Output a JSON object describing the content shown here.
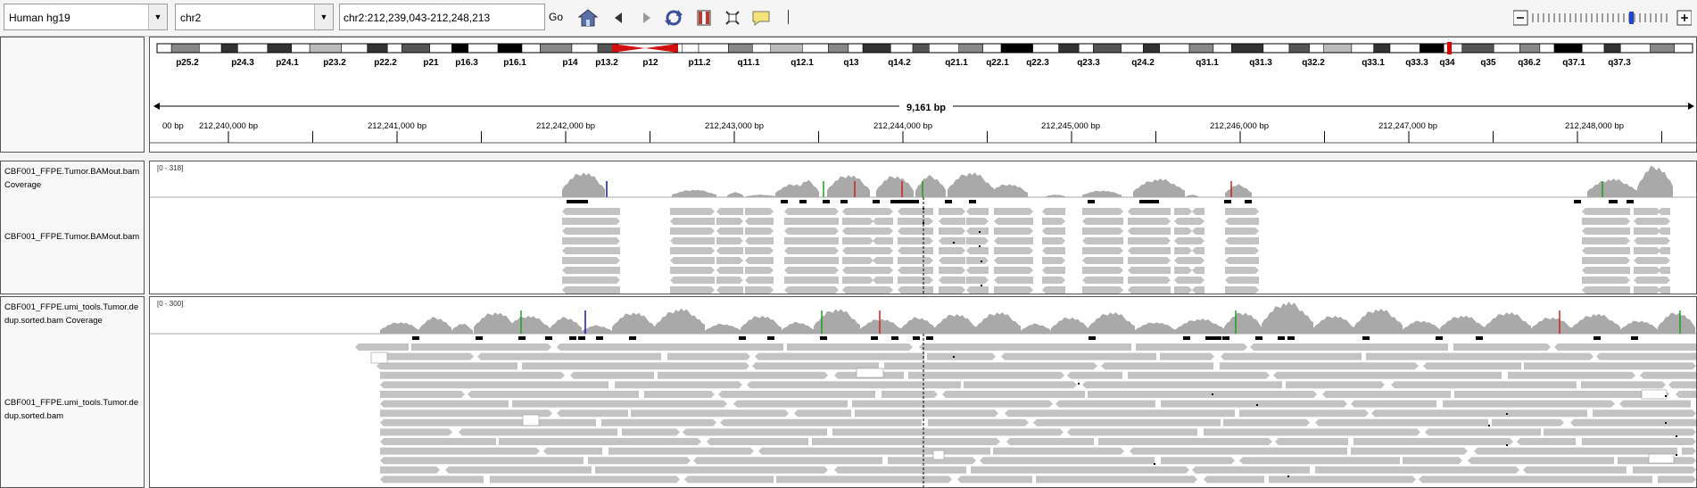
{
  "toolbar": {
    "genome": "Human hg19",
    "chromosome": "chr2",
    "locus": "chr2:212,239,043-212,248,213",
    "go_label": "Go"
  },
  "ideogram": {
    "bands": [
      "p25.2",
      "p24.3",
      "p24.1",
      "p23.2",
      "p22.2",
      "p21",
      "p16.3",
      "p16.1",
      "p14",
      "p13.2",
      "p12",
      "p11.2",
      "q11.1",
      "q12.1",
      "q13",
      "q14.2",
      "q21.1",
      "q22.1",
      "q22.3",
      "q23.3",
      "q24.2",
      "q31.1",
      "q31.3",
      "q32.2",
      "q33.1",
      "q33.3",
      "q34",
      "q35",
      "q36.2",
      "q37.1",
      "q37.3"
    ]
  },
  "ruler": {
    "span_label": "9,161 bp",
    "ticks": [
      "00 bp",
      "212,240,000 bp",
      "212,241,000 bp",
      "212,242,000 bp",
      "212,243,000 bp",
      "212,244,000 bp",
      "212,245,000 bp",
      "212,246,000 bp",
      "212,247,000 bp",
      "212,248,000 bp"
    ]
  },
  "tracks": {
    "t1_coverage_name": "CBF001_FFPE.Tumor.BAMout.bam Coverage",
    "t1_range": "[0 - 318]",
    "t1_alignment_name": "CBF001_FFPE.Tumor.BAMout.bam",
    "t2_coverage_name": "CBF001_FFPE.umi_tools.Tumor.dedup.sorted.bam Coverage",
    "t2_range": "[0 - 300]",
    "t2_alignment_name": "CBF001_FFPE.umi_tools.Tumor.dedup.sorted.bam"
  },
  "colors": {
    "read": "#c3c3c3",
    "coverage": "#a9a9a9",
    "centromere": "#d21010",
    "highlight": "#e00000"
  }
}
